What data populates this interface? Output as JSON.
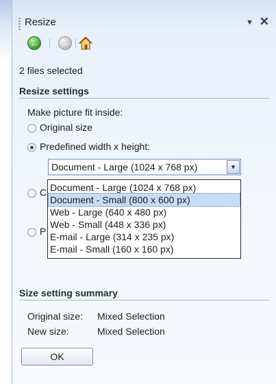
{
  "pane": {
    "title": "Resize",
    "dropdown_glyph": "▼",
    "close_glyph": "✕"
  },
  "nav": {
    "back_glyph": "←",
    "forward_glyph": "→",
    "icons": [
      "back-arrow-icon",
      "forward-arrow-icon",
      "home-icon"
    ]
  },
  "selection_info": "2 files selected",
  "resize_settings": {
    "heading": "Resize settings",
    "fit_label": "Make picture fit inside:",
    "options": [
      {
        "label": "Original size",
        "checked": false
      },
      {
        "label": "Predefined width x height:",
        "checked": true
      }
    ],
    "predefined": {
      "selected": "Document - Large (1024 x 768 px)",
      "list": [
        "Document - Large (1024 x 768 px)",
        "Document - Small (800 x 600 px)",
        "Web - Large (640 x 480 px)",
        "Web - Small (448 x 336 px)",
        "E-mail - Large (314 x 235 px)",
        "E-mail - Small (160 x 160 px)"
      ],
      "highlighted_index": 1
    },
    "obscured_radio_initial_1": "C",
    "obscured_radio_initial_2": "P"
  },
  "summary": {
    "heading": "Size setting summary",
    "rows": [
      {
        "label": "Original size:",
        "value": "Mixed Selection"
      },
      {
        "label": "New size:",
        "value": "Mixed Selection"
      }
    ]
  },
  "ok_label": "OK",
  "colors": {
    "accent": "#2d4f85",
    "highlight": "#c7dcf6"
  }
}
